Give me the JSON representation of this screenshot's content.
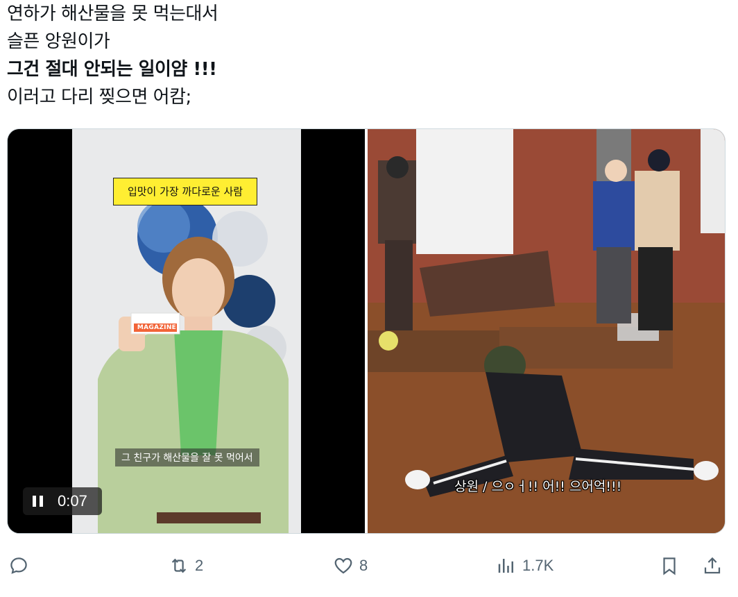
{
  "tweet": {
    "lines": [
      "연하가 해산물을 못 먹는대서",
      "슬픈 앙원이가",
      "그건 절대 안되는 일이얌 !!!",
      "이러고 다리 찢으면 어캄;"
    ]
  },
  "media": {
    "left_video": {
      "top_caption": "입맛이 가장 까다로운 사람",
      "subtitle": "그 친구가 해산물을 잘 못 먹어서",
      "card_text": "MAGAZINE",
      "player_time": "0:07",
      "pause_icon": "pause-icon"
    },
    "right_video": {
      "subtitle": "상원 / 으ㅇㅓ!! 어!! 으어억!!!"
    }
  },
  "actions": {
    "reply": {
      "icon": "reply-icon",
      "count": ""
    },
    "retweet": {
      "icon": "retweet-icon",
      "count": "2"
    },
    "like": {
      "icon": "heart-icon",
      "count": "8"
    },
    "views": {
      "icon": "views-icon",
      "count": "1.7K"
    },
    "bookmark": {
      "icon": "bookmark-icon"
    },
    "share": {
      "icon": "share-icon"
    }
  },
  "colors": {
    "text": "#0f1419",
    "icon_gray": "#536471",
    "caption_yellow": "#ffee32"
  }
}
